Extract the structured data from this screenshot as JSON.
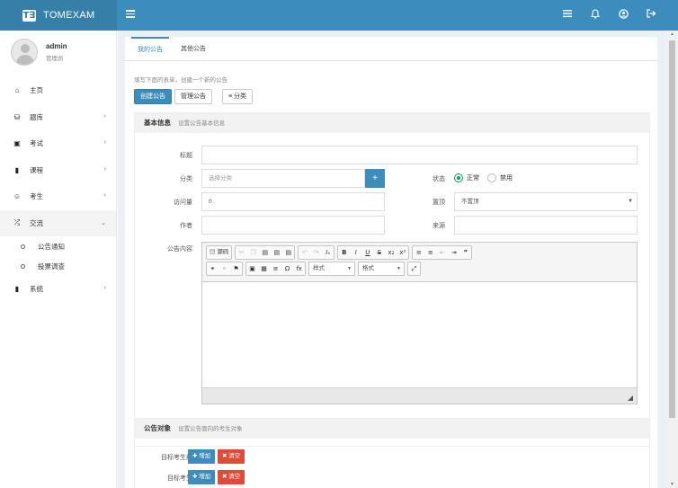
{
  "brand": {
    "name": "TOMEXAM",
    "logo": "T∃"
  },
  "topbar": {
    "icons": [
      "list-icon",
      "bell-icon",
      "user-icon",
      "logout-icon"
    ]
  },
  "user": {
    "name": "admin",
    "role": "管理员"
  },
  "sidebar": {
    "items": [
      {
        "label": "主页",
        "icon": "home-icon"
      },
      {
        "label": "题库",
        "icon": "database-icon"
      },
      {
        "label": "考试",
        "icon": "calendar-icon"
      },
      {
        "label": "课程",
        "icon": "book-icon"
      },
      {
        "label": "考生",
        "icon": "user-icon"
      },
      {
        "label": "交流",
        "icon": "shuffle-icon"
      },
      {
        "label": "系统",
        "icon": "cylinder-icon"
      }
    ],
    "subitems": [
      "公告通知",
      "投票调查"
    ]
  },
  "tabs": [
    "我的公告",
    "其他公告"
  ],
  "hint": "填写下面的表单，创建一个新的公告",
  "actions": {
    "create": "创建公告",
    "manage": "管理公告",
    "category": "分类"
  },
  "basic": {
    "title": "基本信息",
    "subtitle": "设置公告基本信息",
    "labels": {
      "title": "标题",
      "category": "分类",
      "status": "状态",
      "views": "访问量",
      "pin": "置顶",
      "author": "作者",
      "source": "来源",
      "content": "公告内容"
    },
    "category_placeholder": "选择分类",
    "status_options": [
      "正常",
      "禁用"
    ],
    "views_value": "0",
    "pin_value": "不置顶"
  },
  "editor": {
    "source_label": "源码",
    "style_label": "样式",
    "format_label": "格式"
  },
  "target": {
    "title": "公告对象",
    "subtitle": "设置公告面向的考生对象",
    "group_label": "目标考生组",
    "user_label": "目标考生",
    "add_label": "增加",
    "clear_label": "清空"
  },
  "colors": {
    "primary": "#3c8dbc",
    "danger": "#dd4b39",
    "success": "#00a65a"
  }
}
